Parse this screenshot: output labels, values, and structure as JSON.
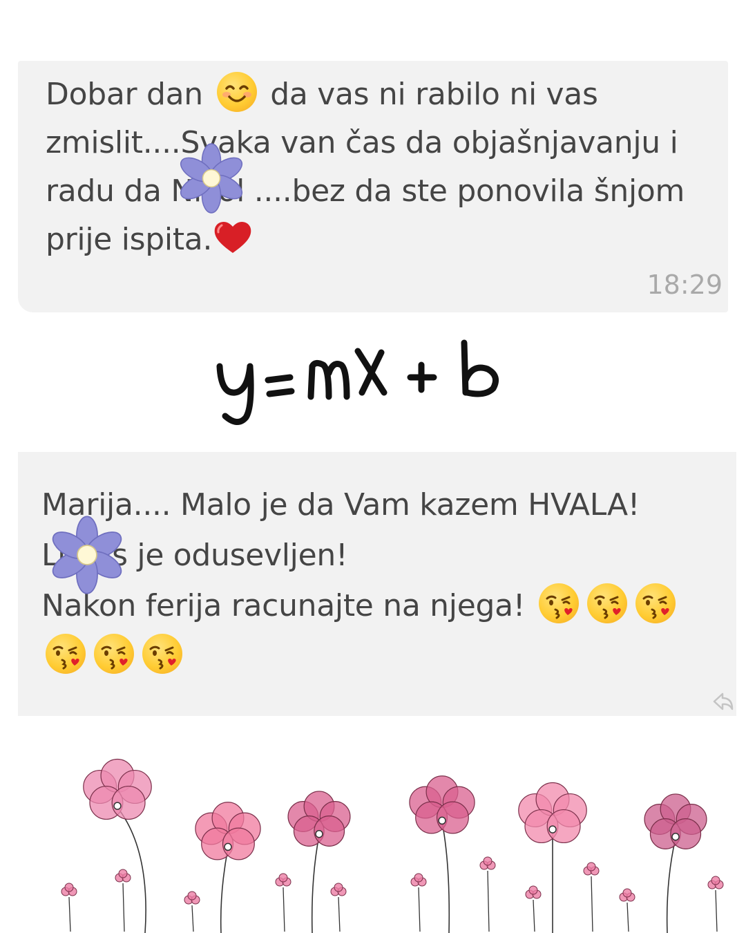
{
  "messages": [
    {
      "lines": [
        {
          "before": "Dobar dan ",
          "emoji": "smiling-face-icon",
          "after": " da vas ni rabilo ni vas"
        },
        {
          "text": "zmislit....Svaka van čas da objašnjavanju i"
        },
        {
          "text": "radu da Nikol ....bez da ste ponovila šnjom"
        },
        {
          "text": "prije ispita.",
          "emoji": "red-heart-icon"
        }
      ],
      "time": "18:29"
    },
    {
      "lines": [
        {
          "text": "Marija.... Malo je da Vam kazem HVALA!"
        },
        {
          "text": "Lukas je odusevljen!"
        },
        {
          "text": "Nakon ferija racunajte na njega! ",
          "emoji": "kissing-face-icon",
          "emoji_count": 3
        },
        {
          "emoji": "kissing-face-icon",
          "emoji_count": 3
        }
      ],
      "reply_icon": "reply-arrow-icon"
    }
  ],
  "equation": "y = mx + b",
  "decorations": {
    "overlay_icon": "purple-flower-icon",
    "footer": "pink-watercolor-flowers"
  },
  "colors": {
    "bubble": "#f2f2f2",
    "text": "#454545",
    "timestamp": "#a9a9a9",
    "purple_flower": "#8f8fd8",
    "pink_flower": "#e8789e"
  }
}
